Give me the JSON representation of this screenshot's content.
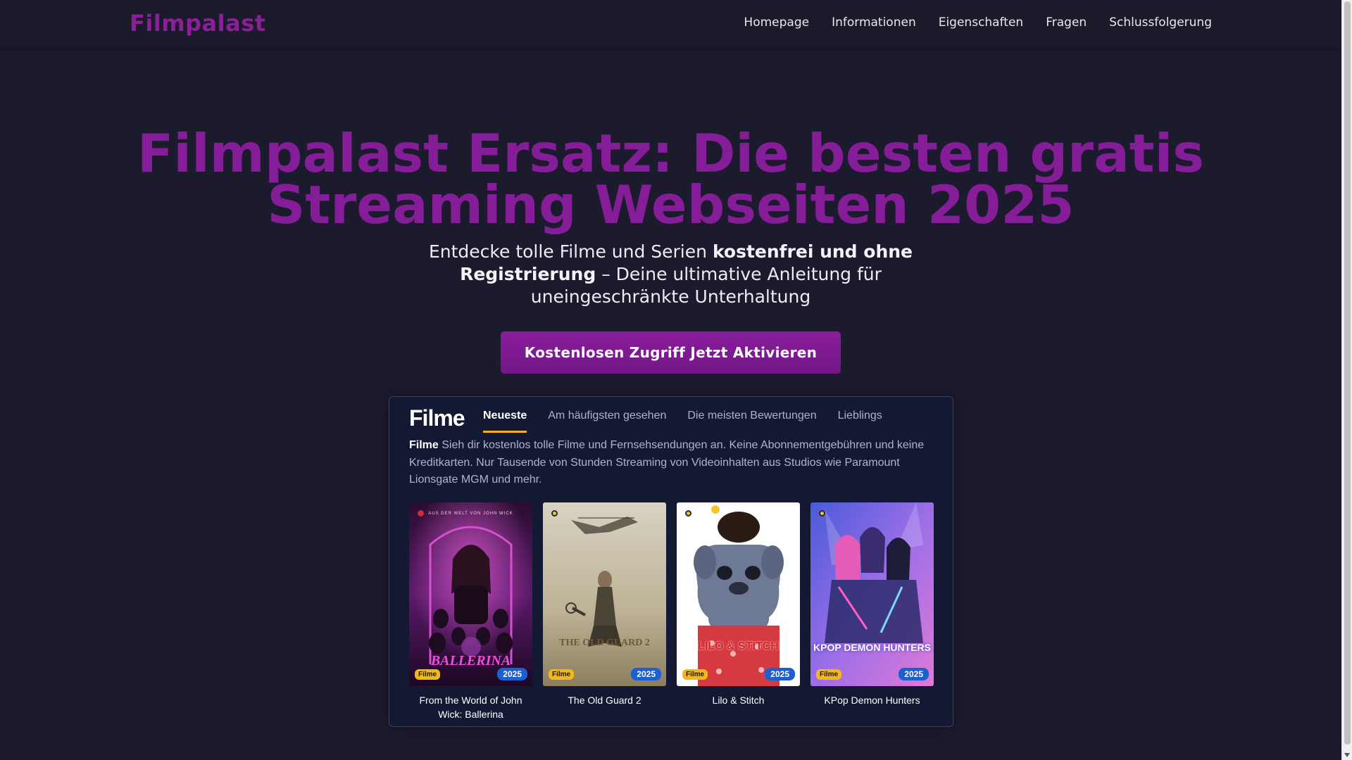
{
  "header": {
    "logo": "Filmpalast",
    "nav": [
      "Homepage",
      "Informationen",
      "Eigenschaften",
      "Fragen",
      "Schlussfolgerung"
    ]
  },
  "hero": {
    "title": "Filmpalast Ersatz: Die besten gratis Streaming Webseiten 2025",
    "subtitle_pre": "Entdecke tolle Filme und Serien ",
    "subtitle_bold": "kostenfrei und ohne Registrierung",
    "subtitle_post": " – Deine ultimative Anleitung für uneingeschränkte Unterhaltung",
    "cta_label": "Kostenlosen Zugriff Jetzt Aktivieren"
  },
  "panel": {
    "logo": "Filme",
    "tabs": [
      {
        "label": "Neueste",
        "active": true
      },
      {
        "label": "Am häufigsten gesehen",
        "active": false
      },
      {
        "label": "Die meisten Bewertungen",
        "active": false
      },
      {
        "label": "Lieblings",
        "active": false
      }
    ],
    "desc_bold": "Filme",
    "desc_text": " Sieh dir kostenlos tolle Filme und Fernsehsendungen an. Keine Abonnementgebühren und keine Kreditkarten. Nur Tausende von Stunden Streaming von Videoinhalten aus Studios wie Paramount Lionsgate MGM und mehr.",
    "movies": [
      {
        "title": "From the World of John Wick: Ballerina",
        "type": "Filme",
        "year": "2025",
        "poster_text": "BALLERINA",
        "poster_top": "AUS DER WELT VON JOHN WICK"
      },
      {
        "title": "The Old Guard 2",
        "type": "Filme",
        "year": "2025",
        "poster_text": "THE OLD GUARD 2",
        "poster_top": ""
      },
      {
        "title": "Lilo & Stitch",
        "type": "Filme",
        "year": "2025",
        "poster_text": "LILO & STITCH",
        "poster_top": ""
      },
      {
        "title": "KPop Demon Hunters",
        "type": "Filme",
        "year": "2025",
        "poster_text": "KPOP DEMON HUNTERS",
        "poster_top": ""
      }
    ]
  },
  "colors": {
    "brand": "#861d98",
    "background": "#1c1b2e",
    "panel": "#141933",
    "tab_underline": "#f2b316",
    "badge_type": "#f3b71b",
    "badge_year": "#1e5fd0"
  }
}
